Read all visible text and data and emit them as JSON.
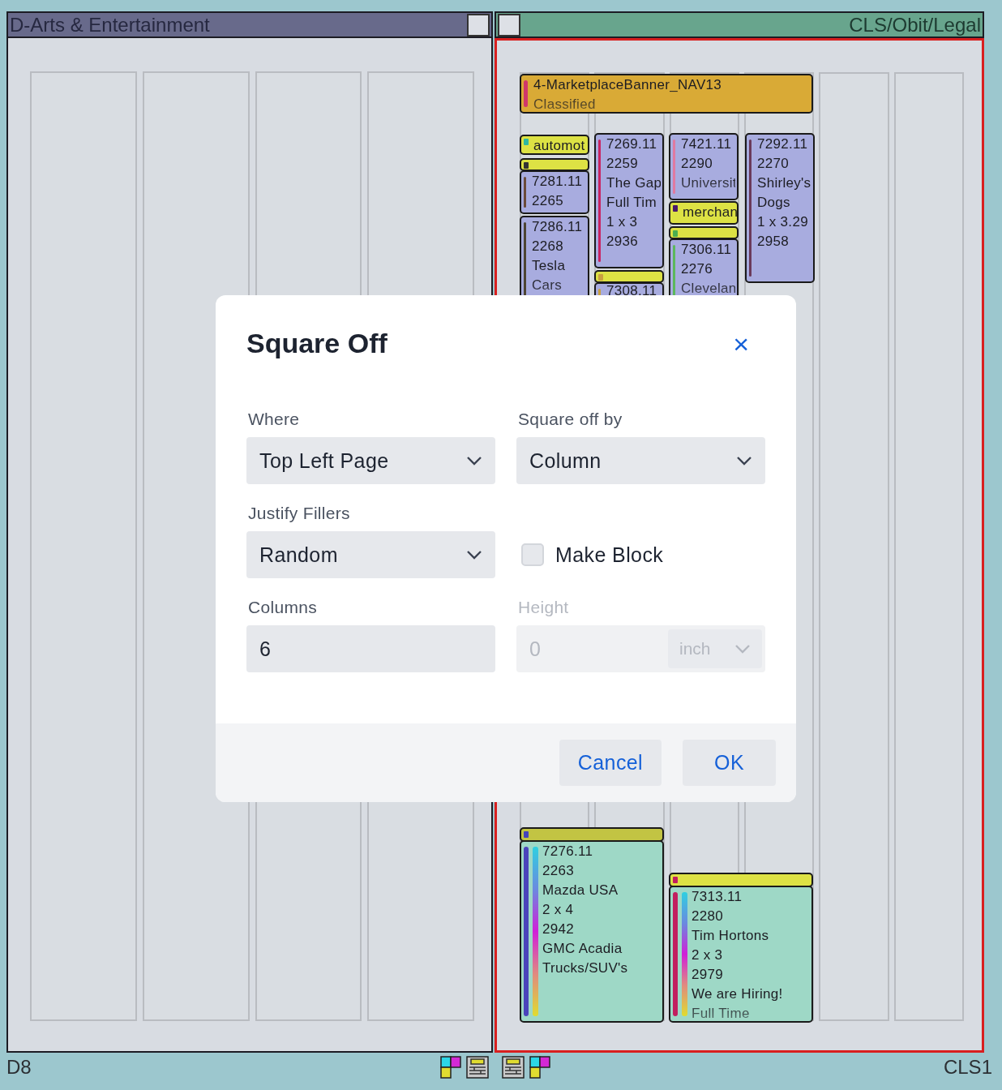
{
  "pages": [
    {
      "title": "D-Arts & Entertainment",
      "selected": false
    },
    {
      "title": "CLS/Obit/Legal",
      "selected": true,
      "cards": [
        {
          "kind": "banner",
          "color": "#d0386a",
          "lines": [
            "4-MarketplaceBanner_NAV13",
            "Classified"
          ]
        },
        {
          "kind": "label",
          "active": true,
          "color": "#2fb8a0",
          "lines": [
            "automot"
          ]
        },
        {
          "kind": "label",
          "active": true,
          "color": "#333333"
        },
        {
          "kind": "ad",
          "color": "#6a4a3a",
          "lines": [
            "7281.11",
            "2265"
          ]
        },
        {
          "kind": "ad",
          "color": "#4d4433",
          "lines": [
            "7286.11",
            "2268",
            "Tesla",
            "Cars"
          ]
        },
        {
          "kind": "ad",
          "color": "#c92462",
          "lines": [
            "7269.11",
            "2259",
            "The Gap",
            "Full Tim",
            "1 x 3",
            "2936"
          ]
        },
        {
          "kind": "label",
          "active": true,
          "color": "#c9a040"
        },
        {
          "kind": "ad",
          "color": "#c9a040",
          "lines": [
            "7308.11"
          ]
        },
        {
          "kind": "ad",
          "color": "#e07aa0",
          "lines": [
            "7421.11",
            "2290",
            "Universit"
          ]
        },
        {
          "kind": "label",
          "active": true,
          "color": "#4a1a6a",
          "lines": [
            "merchan"
          ]
        },
        {
          "kind": "label",
          "active": true,
          "color": "#4caf50"
        },
        {
          "kind": "ad",
          "color": "#5cb85c",
          "lines": [
            "7306.11",
            "2276",
            "Clevelan"
          ]
        },
        {
          "kind": "ad",
          "color": "#6a3a5a",
          "lines": [
            "7292.11",
            "2270",
            "Shirley's",
            "Dogs",
            "1 x 3.29",
            "2958"
          ]
        },
        {
          "kind": "label",
          "active": false,
          "color": "#4444bb"
        },
        {
          "kind": "placed",
          "color": "#4a44bb",
          "lines": [
            "7276.11",
            "2263",
            "Mazda USA",
            "2 x 4",
            "2942",
            "GMC Acadia",
            "Trucks/SUV's"
          ]
        },
        {
          "kind": "label",
          "active": true,
          "color": "#c21f5f"
        },
        {
          "kind": "placed",
          "color": "#c21f5f",
          "lines": [
            "7313.11",
            "2280",
            "Tim Hortons",
            "2 x 3",
            "2979",
            "We are Hiring!",
            "Full Time"
          ]
        }
      ]
    }
  ],
  "footer": {
    "left": "D8",
    "right": "CLS1"
  },
  "dialog": {
    "title": "Square Off",
    "close": "×",
    "fields": [
      {
        "kind": "select",
        "label": "Where",
        "value": "Top Left Page",
        "disabled": false
      },
      {
        "kind": "select",
        "label": "Square off by",
        "value": "Column",
        "disabled": false
      },
      {
        "kind": "select",
        "label": "Justify Fillers",
        "value": "Random",
        "disabled": false
      },
      {
        "kind": "checkbox",
        "label": "Make Block",
        "checked": false,
        "disabled": false
      },
      {
        "kind": "input",
        "label": "Columns",
        "value": "6",
        "disabled": false
      },
      {
        "kind": "unit-input",
        "label": "Height",
        "value": "0",
        "unit": "inch",
        "disabled": true
      }
    ],
    "buttons": [
      "Cancel",
      "OK"
    ]
  }
}
